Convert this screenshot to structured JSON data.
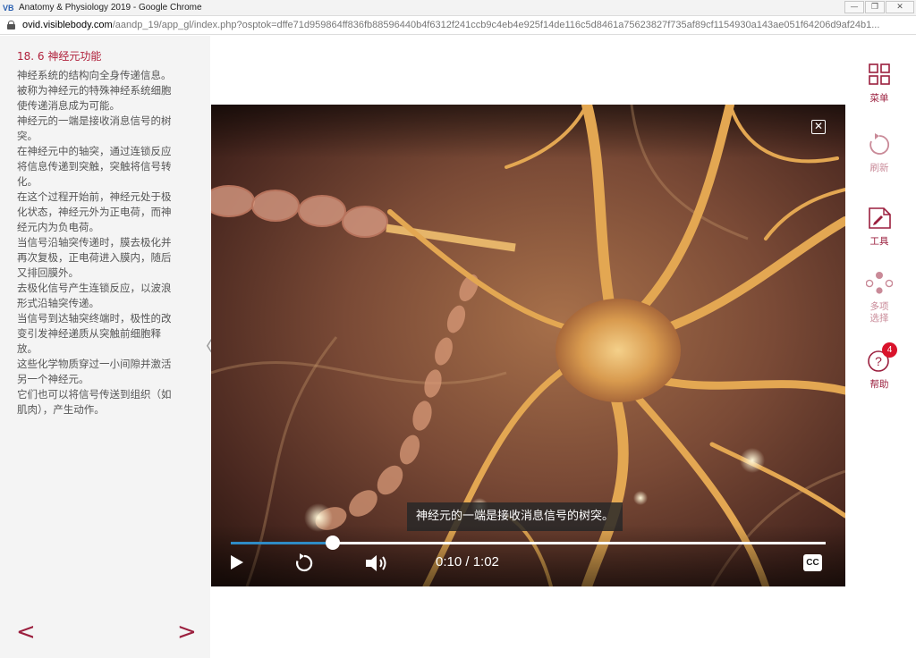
{
  "window": {
    "logo": "VB",
    "title": "Anatomy & Physiology 2019 - Google Chrome",
    "controls": {
      "minimize": "—",
      "maximize": "❐",
      "close": "✕"
    }
  },
  "address_bar": {
    "url_host": "ovid.visiblebody.com",
    "url_path": "/aandp_19/app_gl/index.php?osptok=dffe71d959864ff836fb88596440b4f6312f241ccb9c4eb4e925f14de116c5d8461a75623827f735af89cf1154930a143ae051f64206d9af24b1..."
  },
  "left_panel": {
    "section_title": "18. 6  神经元功能",
    "paragraphs": [
      "神经系统的结构向全身传递信息。",
      "被称为神经元的特殊神经系统细胞使传递消息成为可能。",
      "神经元的一端是接收消息信号的树突。",
      "在神经元中的轴突，通过连锁反应将信息传递到突触，突触将信号转化。",
      "在这个过程开始前，神经元处于极化状态，神经元外为正电荷，而神经元内为负电荷。",
      "当信号沿轴突传递时，膜去极化并再次复极，正电荷进入膜内，随后又排回膜外。",
      "去极化信号产生连锁反应，以波浪形式沿轴突传递。",
      "当信号到达轴突终端时，极性的改变引发神经递质从突触前细胞释放。",
      "这些化学物质穿过一小间隙并激活另一个神经元。",
      "它们也可以将信号传送到组织（如肌肉），产生动作。"
    ],
    "prev_label": "<",
    "next_label": ">",
    "collapse_label": "〈"
  },
  "video": {
    "close_label": "✕",
    "caption": "神经元的一端是接收消息信号的树突。",
    "time": "0:10 / 1:02",
    "progress": 0.172,
    "cc_label": "CC"
  },
  "toolbar": {
    "menu_label": "菜单",
    "refresh_label": "刷新",
    "tools_label": "工具",
    "multi_label_1": "多项",
    "multi_label_2": "选择",
    "help_label": "帮助",
    "help_badge": "4",
    "accent_color": "#9b1f3e"
  }
}
